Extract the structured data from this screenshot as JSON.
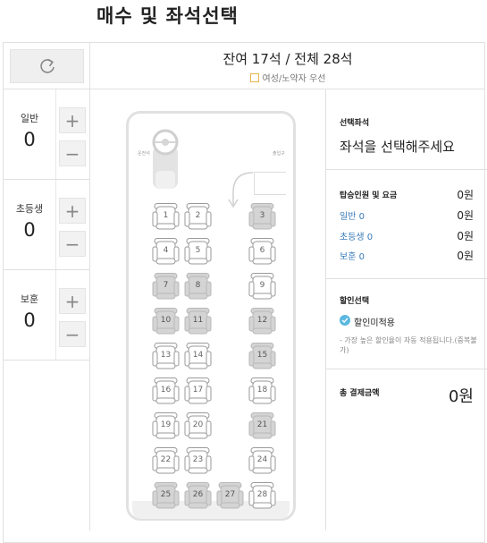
{
  "page": {
    "title": "매수 및 좌석선택"
  },
  "summary": {
    "seat_count": "잔여 17석 / 전체 28석",
    "priority_note": "여성/노약자 우선"
  },
  "passengers": [
    {
      "label": "일반",
      "count": "0"
    },
    {
      "label": "초등생",
      "count": "0"
    },
    {
      "label": "보훈",
      "count": "0"
    }
  ],
  "bus": {
    "driver_label": "운전석",
    "door_label": "출입구",
    "seats": [
      {
        "number": "1",
        "status": "available"
      },
      {
        "number": "2",
        "status": "available"
      },
      {
        "number": "3",
        "status": "sold"
      },
      {
        "number": "4",
        "status": "available"
      },
      {
        "number": "5",
        "status": "available"
      },
      {
        "number": "6",
        "status": "available"
      },
      {
        "number": "7",
        "status": "sold"
      },
      {
        "number": "8",
        "status": "sold"
      },
      {
        "number": "9",
        "status": "available"
      },
      {
        "number": "10",
        "status": "sold"
      },
      {
        "number": "11",
        "status": "sold"
      },
      {
        "number": "12",
        "status": "sold"
      },
      {
        "number": "13",
        "status": "available"
      },
      {
        "number": "14",
        "status": "available"
      },
      {
        "number": "15",
        "status": "sold"
      },
      {
        "number": "16",
        "status": "available"
      },
      {
        "number": "17",
        "status": "available"
      },
      {
        "number": "18",
        "status": "available"
      },
      {
        "number": "19",
        "status": "available"
      },
      {
        "number": "20",
        "status": "available"
      },
      {
        "number": "21",
        "status": "sold"
      },
      {
        "number": "22",
        "status": "available"
      },
      {
        "number": "23",
        "status": "available"
      },
      {
        "number": "24",
        "status": "available"
      },
      {
        "number": "25",
        "status": "sold"
      },
      {
        "number": "26",
        "status": "sold"
      },
      {
        "number": "27",
        "status": "sold"
      },
      {
        "number": "28",
        "status": "available"
      }
    ]
  },
  "selected": {
    "title": "선택좌석",
    "placeholder": "좌석을 선택해주세요"
  },
  "fare": {
    "title": "탑승인원 및 요금",
    "title_value": "0원",
    "lines": [
      {
        "label": "일반 0",
        "value": "0원"
      },
      {
        "label": "초등생 0",
        "value": "0원"
      },
      {
        "label": "보훈 0",
        "value": "0원"
      }
    ]
  },
  "discount": {
    "title": "할인선택",
    "option": "할인미적용",
    "note": "- 가장 높은 할인율이 자동 적용됩니다.(중복불가)"
  },
  "total": {
    "label": "총 결제금액",
    "value": "0원"
  },
  "colors": {
    "sold_seat": "#d4d4d4",
    "available_seat": "#ffffff",
    "check": "#5bb8e0",
    "fare_link": "#3a7ab8"
  }
}
